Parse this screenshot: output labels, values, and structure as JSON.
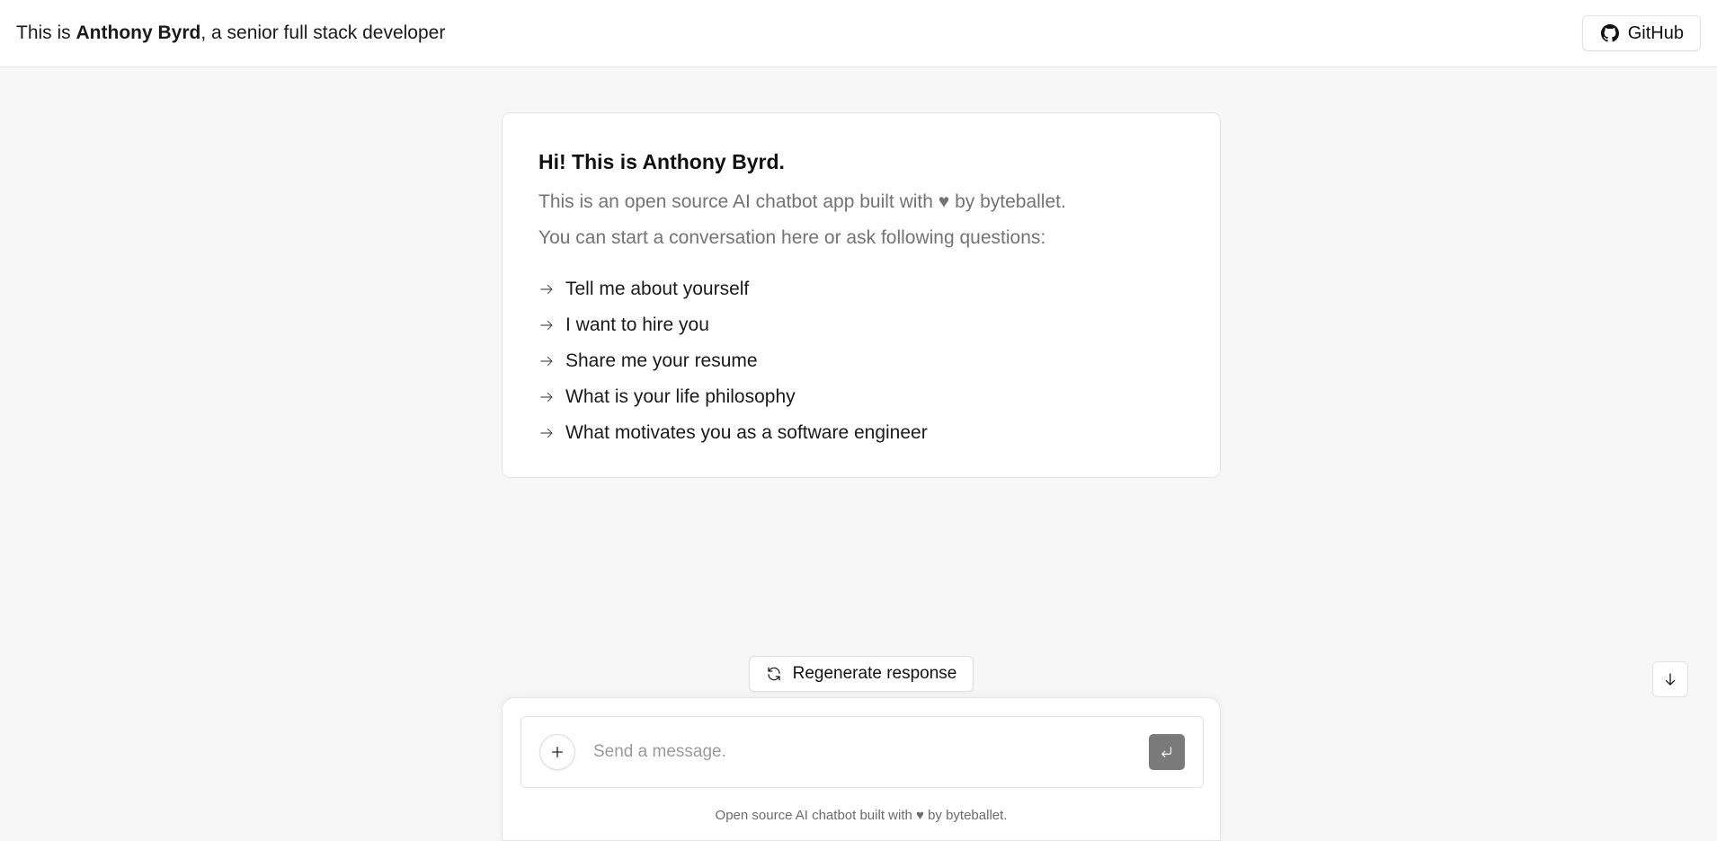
{
  "header": {
    "title_prefix": "This is ",
    "title_name": "Anthony Byrd",
    "title_suffix": ", a senior full stack developer",
    "github_label": "GitHub"
  },
  "intro": {
    "heading": "Hi! This is Anthony Byrd.",
    "line1": "This is an open source AI chatbot app built with ♥ by byteballet.",
    "line2": "You can start a conversation here or ask following questions:",
    "questions": [
      "Tell me about yourself",
      "I want to hire you",
      "Share me your resume",
      "What is your life philosophy",
      "What motivates you as a software engineer"
    ]
  },
  "actions": {
    "regenerate_label": "Regenerate response"
  },
  "composer": {
    "placeholder": "Send a message.",
    "value": "",
    "footer_note": "Open source AI chatbot built with ♥ by byteballet."
  },
  "icons": {
    "github": "github-icon",
    "arrow": "arrow-right-icon",
    "regenerate": "refresh-icon",
    "scroll": "arrow-down-icon",
    "plus": "plus-icon",
    "send": "enter-icon"
  },
  "colors": {
    "background": "#f7f7f7",
    "surface": "#ffffff",
    "border": "#e3e3e3",
    "muted_text": "#737373",
    "send_button": "#7a7a7a"
  }
}
